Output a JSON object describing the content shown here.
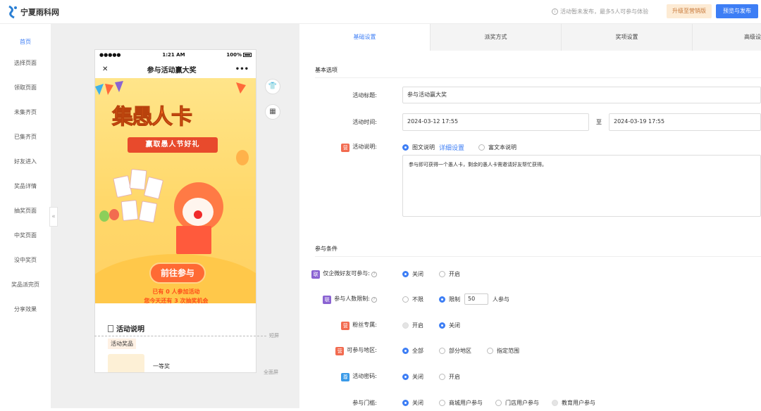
{
  "app": {
    "logo_text": "宁夏雨科网"
  },
  "header": {
    "notice": "活动暂未发布，最多5人可参与体验",
    "upgrade_label": "升级至营销版",
    "publish_label": "预览与发布"
  },
  "sidebar": {
    "items": [
      "首页",
      "选择页面",
      "领取页面",
      "未集齐页",
      "已集齐页",
      "好友进入",
      "奖品详情",
      "抽奖页面",
      "中奖页面",
      "没中奖页",
      "奖品派完页",
      "分享效果"
    ]
  },
  "phone": {
    "time": "1:21 AM",
    "battery": "100%",
    "signal": "●●●●●",
    "title": "参与活动赢大奖",
    "close_glyph": "✕",
    "more_glyph": "•••",
    "hero_title": "集愚人卡",
    "ribbon": "赢取愚人节好礼",
    "go_button": "前往参与",
    "promo_line1": "已有 0 人参加活动",
    "promo_line2": "您今天还有 3 次抽奖机会",
    "info_title": "活动说明",
    "prize_tag": "活动奖品",
    "prize_name": "一等奖"
  },
  "canvas": {
    "short_screen": "短屏",
    "full_screen": "全面屏",
    "collapse_glyph": "«"
  },
  "tabs": [
    "基础设置",
    "派奖方式",
    "奖项设置",
    "高级设"
  ],
  "form": {
    "section_basic": "基本选项",
    "title_label": "活动标题:",
    "title_value": "参与活动赢大奖",
    "time_label": "活动时间:",
    "start_time": "2024-03-12 17:55",
    "to": "至",
    "end_time": "2024-03-19 17:55",
    "desc_badge": "营",
    "desc_label": "活动说明:",
    "desc_opt1": "图文说明",
    "desc_link": "详细设置",
    "desc_opt2": "富文本说明",
    "desc_text": "参与即可获得一个愚人卡，剩余的愚人卡需邀请好友帮忙获得。",
    "section_conditions": "参与条件",
    "wechat_badge": "联",
    "wechat_label": "仅企微好友可参与:",
    "wechat_off": "关闭",
    "wechat_on": "开启",
    "limit_badge": "联",
    "limit_label": "参与人数限制:",
    "limit_none": "不限",
    "limit_yes": "限制",
    "limit_value": "50",
    "limit_suffix": "人参与",
    "fans_badge": "营",
    "fans_label": "粉丝专属:",
    "fans_on": "开启",
    "fans_off": "关闭",
    "region_badge": "营",
    "region_label": "可参与地区:",
    "region_all": "全部",
    "region_part": "部分地区",
    "region_range": "指定范围",
    "pwd_badge": "尊",
    "pwd_label": "活动密码:",
    "pwd_off": "关闭",
    "pwd_on": "开启",
    "door_label": "参与门槛:",
    "door_off": "关闭",
    "door_mall": "商城用户参与",
    "door_store": "门店用户参与",
    "door_edu": "教育用户参与"
  }
}
